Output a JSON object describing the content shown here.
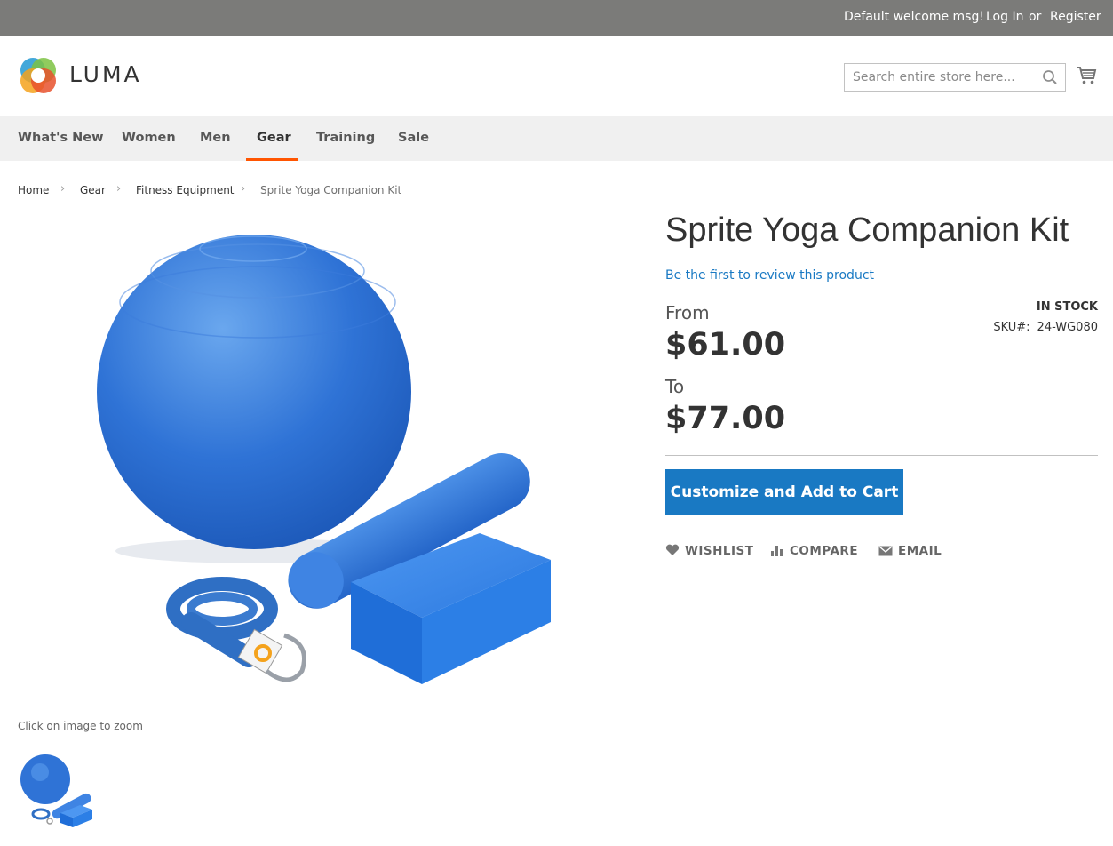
{
  "header": {
    "welcome": "Default welcome msg!",
    "login": "Log In",
    "or": "or",
    "register": "Register",
    "logo_text": "LUMA",
    "search_placeholder": "Search entire store here..."
  },
  "nav": {
    "items": [
      "What's New",
      "Women",
      "Men",
      "Gear",
      "Training",
      "Sale"
    ],
    "active": "Gear"
  },
  "breadcrumb": [
    "Home",
    "Gear",
    "Fitness Equipment",
    "Sprite Yoga Companion Kit"
  ],
  "gallery": {
    "zoom_hint": "Click on image to zoom"
  },
  "product": {
    "title": "Sprite Yoga Companion Kit",
    "review_link": "Be the first to review this product",
    "from_label": "From",
    "price_from": "$61.00",
    "to_label": "To",
    "price_to": "$77.00",
    "stock": "IN STOCK",
    "sku_label": "SKU#:",
    "sku": "24-WG080",
    "add_button": "Customize and Add to Cart",
    "actions": [
      "WISHLIST",
      "COMPARE",
      "EMAIL"
    ]
  },
  "colors": {
    "accent": "#1979c3",
    "nav_active": "#ff5501",
    "topbar": "#7b7b79"
  }
}
